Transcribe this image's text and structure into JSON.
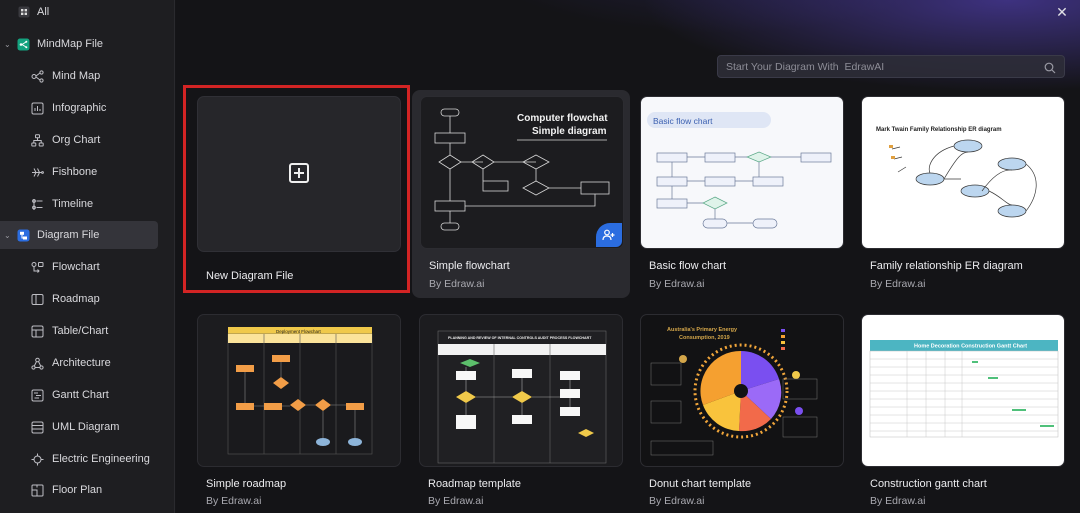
{
  "sidebar": {
    "all": {
      "label": "All",
      "icon": "grid-icon"
    },
    "groups": [
      {
        "label": "MindMap File",
        "icon": "mindmap-file-icon",
        "expanded": true,
        "items": [
          {
            "label": "Mind Map",
            "icon": "mindmap-icon"
          },
          {
            "label": "Infographic",
            "icon": "infographic-icon"
          },
          {
            "label": "Org Chart",
            "icon": "org-chart-icon"
          },
          {
            "label": "Fishbone",
            "icon": "fishbone-icon"
          },
          {
            "label": "Timeline",
            "icon": "timeline-icon"
          }
        ]
      },
      {
        "label": "Diagram File",
        "icon": "diagram-file-icon",
        "expanded": true,
        "active": true,
        "items": [
          {
            "label": "Flowchart",
            "icon": "flowchart-icon"
          },
          {
            "label": "Roadmap",
            "icon": "roadmap-icon"
          },
          {
            "label": "Table/Chart",
            "icon": "table-chart-icon"
          },
          {
            "label": "Architecture",
            "icon": "architecture-icon"
          },
          {
            "label": "Gantt Chart",
            "icon": "gantt-icon"
          },
          {
            "label": "UML Diagram",
            "icon": "uml-icon"
          },
          {
            "label": "Electric Engineering",
            "icon": "electric-icon"
          },
          {
            "label": "Floor Plan",
            "icon": "floor-plan-icon"
          }
        ]
      }
    ]
  },
  "search": {
    "placeholder": "Start Your Diagram With  EdrawAI"
  },
  "new_file": {
    "label": "New Diagram File"
  },
  "templates": [
    {
      "title": "Simple flowchart",
      "author": "By Edraw.ai",
      "thumb_heading_1": "Computer flowchat",
      "thumb_heading_2": "Simple diagram"
    },
    {
      "title": "Basic flow chart",
      "author": "By Edraw.ai",
      "thumb_heading": "Basic flow chart"
    },
    {
      "title": "Family relationship ER diagram",
      "author": "By Edraw.ai",
      "thumb_heading": "Mark Twain Family Relationship ER diagram"
    },
    {
      "title": "Simple roadmap",
      "author": "By Edraw.ai",
      "thumb_heading": "Deployment Flowchart"
    },
    {
      "title": "Roadmap template",
      "author": "By Edraw.ai",
      "thumb_heading": "PLANNING AND REVIEW OF INTERNAL CONTROLS AUDIT PROCESS FLOWCHART"
    },
    {
      "title": "Donut chart template",
      "author": "By Edraw.ai",
      "thumb_heading_1": "Australia's Primary Energy",
      "thumb_heading_2": "Consumption, 2019"
    },
    {
      "title": "Construction gantt chart",
      "author": "By Edraw.ai",
      "thumb_heading": "Home Decoration Construction Gantt Chart"
    }
  ],
  "colors": {
    "accent": "#2b6de0",
    "highlight": "#d32424",
    "sidebar_active": "#34343a"
  }
}
